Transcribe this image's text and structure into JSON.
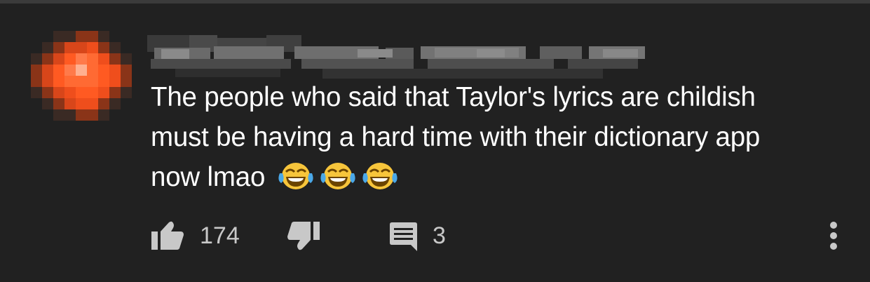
{
  "comment": {
    "text": "The people who said that Taylor's lyrics are childish\nmust be having a hard time with their dictionary app\nnow lmao ",
    "emojis": [
      "face-with-tears-of-joy",
      "face-with-tears-of-joy",
      "face-with-tears-of-joy"
    ]
  },
  "actions": {
    "like_icon": "thumbs-up-icon",
    "like_count": "174",
    "dislike_icon": "thumbs-down-icon",
    "reply_icon": "comment-icon",
    "reply_count": "3",
    "more_icon": "more-vertical-icon"
  },
  "colors": {
    "background": "#212121",
    "text": "#ffffff",
    "secondary_text": "#c8c8c8",
    "avatar_accent": "#ff5722"
  }
}
